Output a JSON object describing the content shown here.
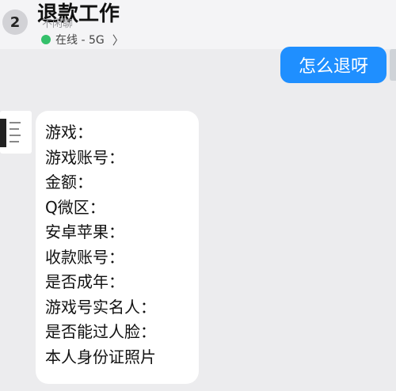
{
  "header": {
    "unread_count": "2",
    "title": "退款工作",
    "faint_subtitle": "不闲聊",
    "status_text": "在线 - 5G",
    "chevron": "〉",
    "status_color": "#34c06b"
  },
  "outgoing_message": {
    "text": "怎么退呀",
    "bubble_color": "#1f8fff"
  },
  "incoming_message": {
    "lines": [
      "游戏：",
      "游戏账号：",
      "金额：",
      "Q微区：",
      "安卓苹果：",
      "收款账号：",
      "是否成年：",
      "游戏号实名人：",
      "是否能过人脸：",
      "本人身份证照片"
    ]
  }
}
